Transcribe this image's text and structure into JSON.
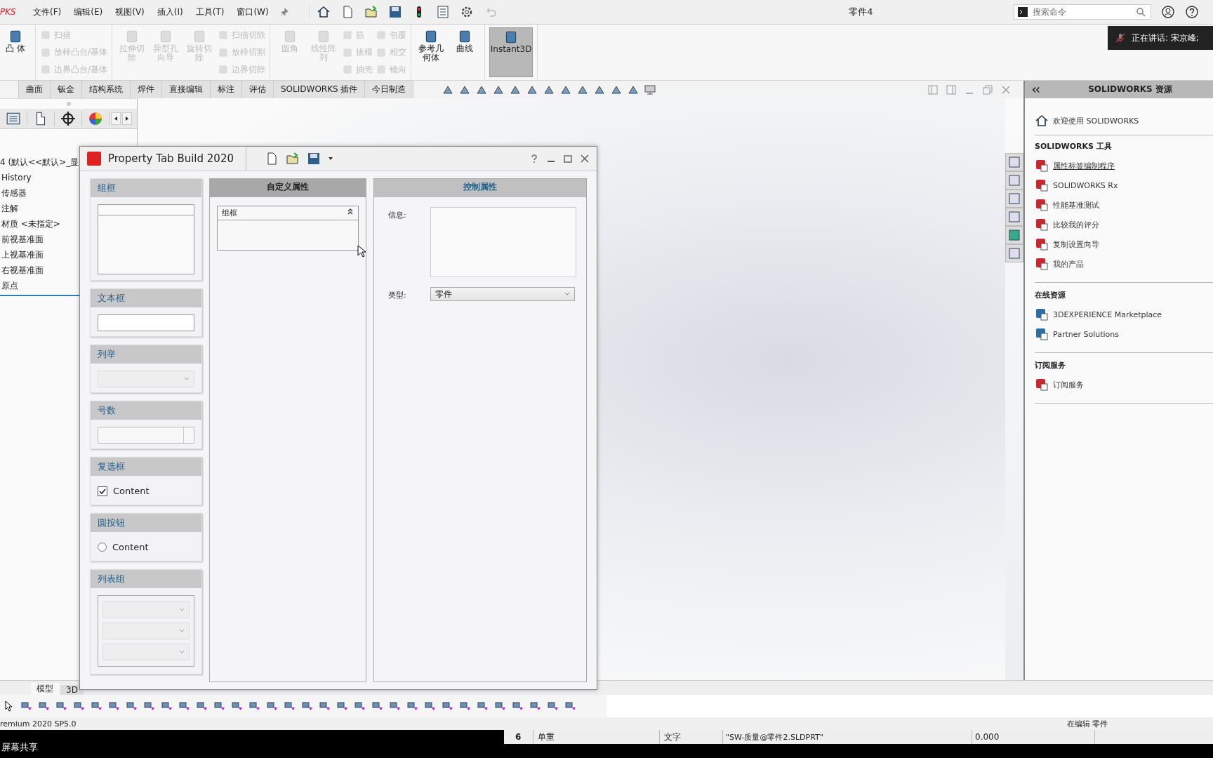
{
  "app_bar": {
    "logo": "PKS",
    "menus": [
      "文件(F)",
      "编辑(E)",
      "视图(V)",
      "插入(I)",
      "工具(T)",
      "窗口(W)"
    ],
    "title": "零件4",
    "search": {
      "placeholder": "搜索命令"
    }
  },
  "notification": {
    "text": "正在讲话: 宋京峰;"
  },
  "ribbon": {
    "groups": [
      [
        [
          {
            "label": "凸 体",
            "kind": "large",
            "disabled": false,
            "pressed": false
          }
        ]
      ],
      [
        [
          {
            "label": "扫描",
            "kind": "small",
            "disabled": true,
            "pressed": false
          },
          {
            "label": "放样凸台/基体",
            "kind": "small",
            "disabled": true,
            "pressed": false
          },
          {
            "label": "边界凸台/基体",
            "kind": "small",
            "disabled": true,
            "pressed": false
          }
        ]
      ],
      [
        [
          {
            "label": "拉伸切除",
            "kind": "large",
            "disabled": true,
            "pressed": false
          }
        ],
        [
          {
            "label": "异型孔向导",
            "kind": "large",
            "disabled": true,
            "pressed": false
          }
        ],
        [
          {
            "label": "旋转切除",
            "kind": "large",
            "disabled": true,
            "pressed": false
          }
        ],
        [
          {
            "label": "扫描切除",
            "kind": "small",
            "disabled": true,
            "pressed": false
          },
          {
            "label": "放样切割",
            "kind": "small",
            "disabled": true,
            "pressed": false
          },
          {
            "label": "边界切除",
            "kind": "small",
            "disabled": true,
            "pressed": false
          }
        ]
      ],
      [
        [
          {
            "label": "圆角",
            "kind": "large",
            "disabled": true,
            "pressed": false
          }
        ],
        [
          {
            "label": "线性阵列",
            "kind": "large",
            "disabled": true,
            "pressed": false
          }
        ],
        [
          {
            "label": "筋",
            "kind": "small",
            "disabled": true,
            "pressed": false
          },
          {
            "label": "拔模",
            "kind": "small",
            "disabled": true,
            "pressed": false
          },
          {
            "label": "抽壳",
            "kind": "small",
            "disabled": true,
            "pressed": false
          }
        ],
        [
          {
            "label": "包覆",
            "kind": "small",
            "disabled": true,
            "pressed": false
          },
          {
            "label": "相交",
            "kind": "small",
            "disabled": true,
            "pressed": false
          },
          {
            "label": "镜向",
            "kind": "small",
            "disabled": true,
            "pressed": false
          }
        ]
      ],
      [
        [
          {
            "label": "参考几何体",
            "kind": "large",
            "disabled": false,
            "pressed": false
          }
        ],
        [
          {
            "label": "曲线",
            "kind": "large",
            "disabled": false,
            "pressed": false
          }
        ]
      ],
      [
        [
          {
            "label": "Instant3D",
            "kind": "large",
            "disabled": false,
            "pressed": true
          }
        ]
      ]
    ]
  },
  "tabs": [
    {
      "label": "曲面",
      "selected": false
    },
    {
      "label": "钣金",
      "selected": false
    },
    {
      "label": "结构系统",
      "selected": false
    },
    {
      "label": "焊件",
      "selected": false
    },
    {
      "label": "直接编辑",
      "selected": false
    },
    {
      "label": "标注",
      "selected": false
    },
    {
      "label": "评估",
      "selected": false
    },
    {
      "label": "SOLIDWORKS 插件",
      "selected": false
    },
    {
      "label": "今日制造",
      "selected": false
    }
  ],
  "feature_tree": {
    "root": "4 (默认<<默认>_显",
    "items": [
      "History",
      "传感器",
      "注解",
      "材质 <未指定>",
      "前视基准面",
      "上视基准面",
      "右视基准面",
      "原点"
    ]
  },
  "dialog": {
    "title": "Property Tab Build  2020",
    "palette": [
      {
        "label": "组框",
        "kind": "group_box"
      },
      {
        "label": "文本框",
        "kind": "text_box"
      },
      {
        "label": "列举",
        "kind": "combo"
      },
      {
        "label": "号数",
        "kind": "number"
      },
      {
        "label": "复选框",
        "kind": "checkbox",
        "option": "Content",
        "checked": true
      },
      {
        "label": "圆按钮",
        "kind": "radio",
        "option": "Content",
        "checked": false
      },
      {
        "label": "列表组",
        "kind": "list_group"
      }
    ],
    "custom": {
      "header": "自定义属性",
      "group_box": "组框"
    },
    "control": {
      "header": "控制属性",
      "info_label": "信息:",
      "type_label": "类型:",
      "type_value": "零件"
    }
  },
  "resources": {
    "header": "SOLIDWORKS 资源",
    "welcome": "欢迎使用  SOLIDWORKS",
    "sections": [
      {
        "title": "SOLIDWORKS 工具",
        "items": [
          {
            "label": "属性标签编制程序",
            "hovered": true
          },
          {
            "label": "SOLIDWORKS Rx",
            "hovered": false
          },
          {
            "label": "性能基准测试",
            "hovered": false
          },
          {
            "label": "比较我的评分",
            "hovered": false
          },
          {
            "label": "复制设置向导",
            "hovered": false
          },
          {
            "label": "我的产品",
            "hovered": false
          }
        ]
      },
      {
        "title": "在线资源",
        "items": [
          {
            "label": "3DEXPERIENCE Marketplace",
            "hovered": false
          },
          {
            "label": "Partner Solutions",
            "hovered": false
          }
        ]
      },
      {
        "title": "订阅服务",
        "items": [
          {
            "label": "订阅服务",
            "hovered": false
          }
        ]
      }
    ]
  },
  "model_tabs": [
    {
      "label": "模型",
      "selected": true
    },
    {
      "label": "3D",
      "selected": false
    }
  ],
  "status_bar": {
    "version": "remium 2020 SP5.0",
    "mode": "在编辑 零件"
  },
  "share_bar": {
    "label": "屏幕共享",
    "row": [
      "6",
      "单重",
      "文字",
      "\"SW-质量@零件2.SLDPRT\"",
      "0.000"
    ]
  }
}
